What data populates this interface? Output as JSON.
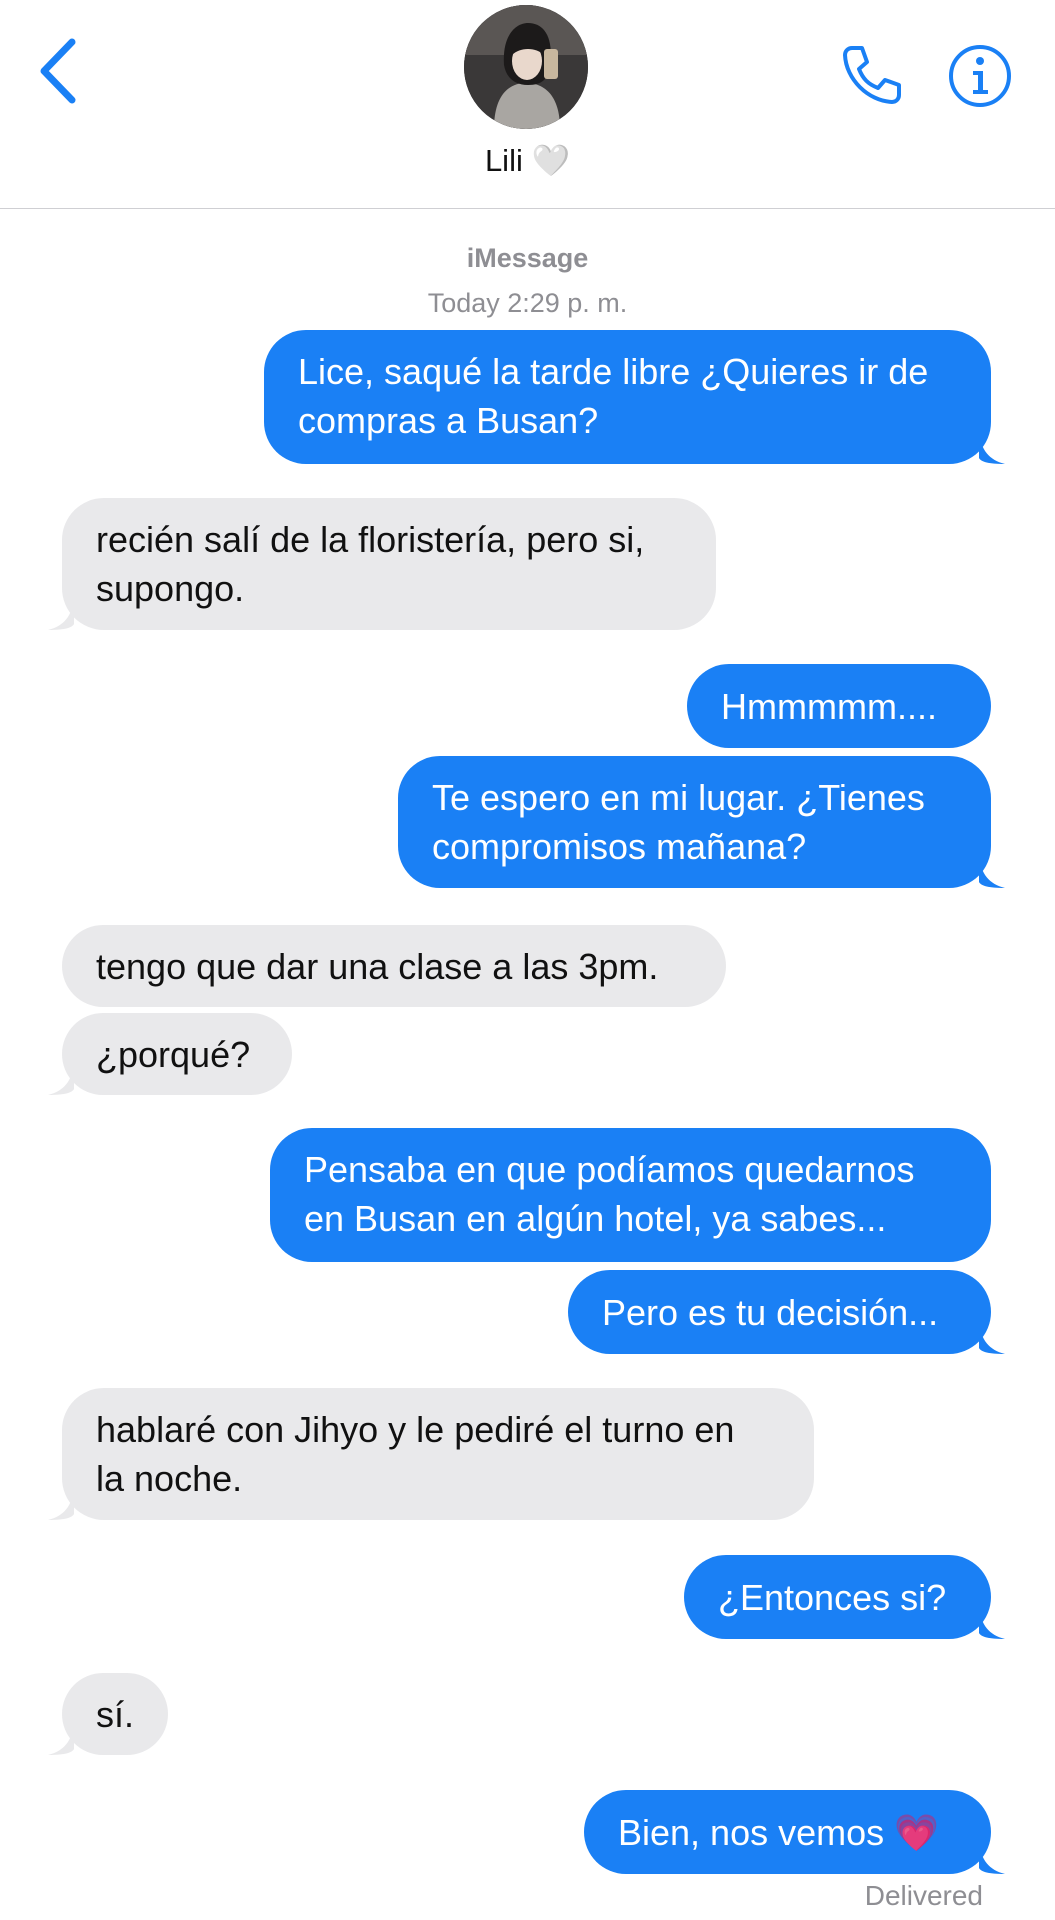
{
  "header": {
    "contact_name": "Lili 🤍",
    "back_icon": "chevron-left-icon",
    "call_icon": "phone-icon",
    "info_icon": "info-icon",
    "accent_color": "#1a80f5"
  },
  "conversation": {
    "service": "iMessage",
    "timestamp": "Today 2:29 p. m."
  },
  "messages": [
    {
      "from": "me",
      "text": "Lice, saqué la tarde libre ¿Quieres ir de\ncompras a Busan?"
    },
    {
      "from": "them",
      "text": "recién salí de la floristería, pero si,\nsupongo."
    },
    {
      "from": "me",
      "text": "Hmmmmm...."
    },
    {
      "from": "me",
      "text": "Te espero en mi lugar. ¿Tienes\ncompromisos mañana?"
    },
    {
      "from": "them",
      "text": "tengo que dar una clase a las 3pm."
    },
    {
      "from": "them",
      "text": "¿porqué?"
    },
    {
      "from": "me",
      "text": "Pensaba en que podíamos quedarnos\nen Busan en algún hotel, ya sabes..."
    },
    {
      "from": "me",
      "text": "Pero es tu decisión..."
    },
    {
      "from": "them",
      "text": "hablaré con Jihyo y le pediré el turno en\nla noche."
    },
    {
      "from": "me",
      "text": "¿Entonces si?"
    },
    {
      "from": "them",
      "text": "sí."
    },
    {
      "from": "me",
      "text": "Bien, nos vemos 💗"
    }
  ],
  "status": {
    "delivery": "Delivered"
  }
}
